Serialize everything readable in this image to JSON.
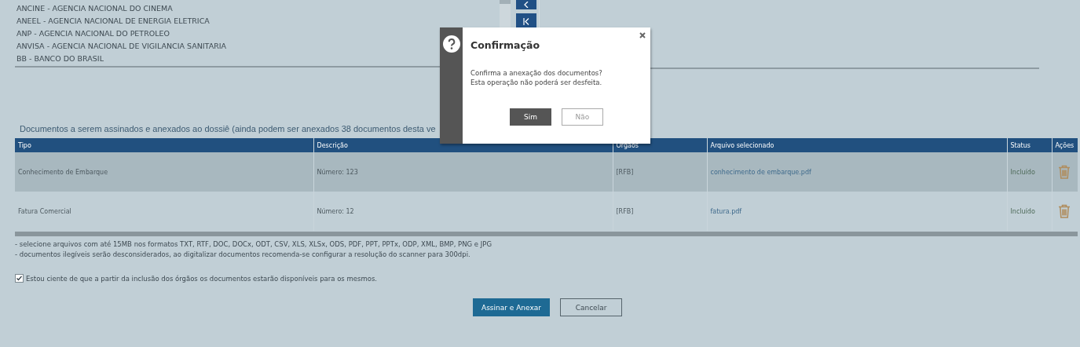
{
  "agency_list": {
    "items": [
      "ANCINE - AGENCIA NACIONAL DO CINEMA",
      "ANEEL - AGENCIA NACIONAL DE ENERGIA ELETRICA",
      "ANP - AGENCIA NACIONAL DO PETROLEO",
      "ANVISA - AGENCIA NACIONAL DE VIGILANCIA SANITARIA",
      "BB - BANCO DO BRASIL"
    ]
  },
  "documents": {
    "heading": "Documentos a serem assinados e anexados ao dossiê (ainda podem ser anexados 38 documentos desta ve",
    "columns": [
      "Tipo",
      "Descrição",
      "Orgaos",
      "Arquivo selecionado",
      "Status",
      "Ações"
    ],
    "rows": [
      {
        "tipo": "Conhecimento de Embarque",
        "descricao": "Número: 123",
        "orgaos": "[RFB]",
        "arquivo": "conhecimento de embarque.pdf",
        "status": "Incluído",
        "selected": true
      },
      {
        "tipo": "Fatura Comercial",
        "descricao": "Número: 12",
        "orgaos": "[RFB]",
        "arquivo": "fatura.pdf",
        "status": "Incluído",
        "selected": false
      }
    ]
  },
  "notes": [
    "- selecione arquivos com até 15MB nos formatos TXT, RTF, DOC, DOCx, ODT, CSV, XLS, XLSx, ODS, PDF, PPT, PPTx, ODP, XML, BMP, PNG e JPG",
    "- documentos ilegíveis serão desconsiderados, ao digitalizar documentos recomenda-se configurar a resolução do scanner para 300dpi."
  ],
  "acknowledgement": {
    "label": "Estou ciente de que a partir da inclusão dos órgãos os documentos estarão disponíveis para os mesmos.",
    "checked": true
  },
  "buttons": [
    {
      "label": "Assinar e Anexar",
      "kind": "primary"
    },
    {
      "label": "Cancelar",
      "kind": "secondary"
    }
  ],
  "dialog": {
    "title": "Confirmação",
    "message": "Confirma a anexação dos documentos? Esta operação não poderá ser desfeita.",
    "buttons": [
      {
        "label": "Sim",
        "kind": "primary"
      },
      {
        "label": "Não",
        "kind": "secondary"
      }
    ]
  }
}
